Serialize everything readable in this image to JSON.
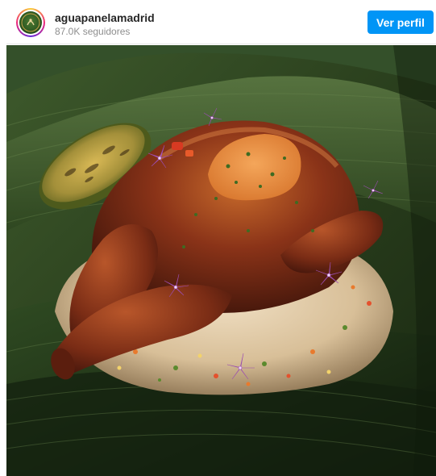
{
  "profile": {
    "username": "aguapanelamadrid",
    "followers": "87.0K seguidores",
    "view_profile_label": "Ver perfil"
  },
  "colors": {
    "primary_button": "#0095f6",
    "username_text": "#262626",
    "secondary_text": "#8e8e8e"
  },
  "icons": {
    "avatar": "restaurant-logo"
  }
}
